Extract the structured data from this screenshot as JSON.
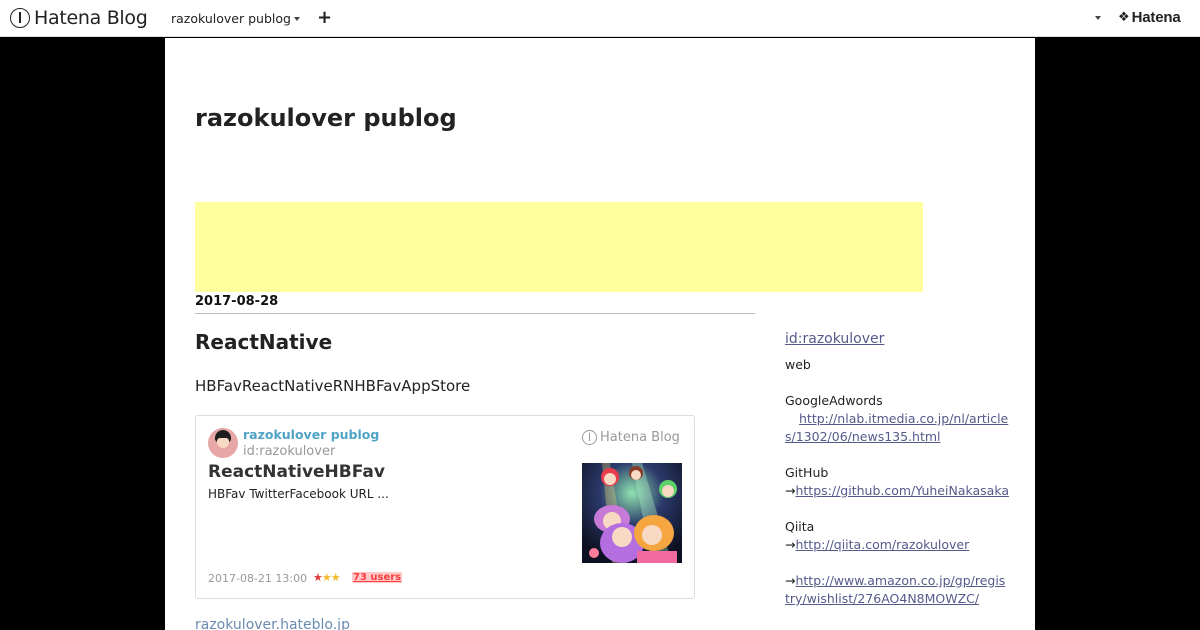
{
  "topbar": {
    "logo_text": "Hatena Blog",
    "blog_switcher_label": "razokulover publog",
    "add_label": "+",
    "brand_mark": "❖",
    "brand_text": "Hatena"
  },
  "blog": {
    "title": "razokulover publog",
    "url": "razokulover.hateblo.jp"
  },
  "ad": {
    "color": "#ffff9e"
  },
  "entry": {
    "date": "2017-08-28",
    "title": "ReactNative",
    "text": "HBFavReactNativeRNHBFavAppStore"
  },
  "card": {
    "blog_name": "razokulover publog",
    "author_id": "id:razokulover",
    "logo_text": "Hatena Blog",
    "title": "ReactNativeHBFav",
    "description": "HBFav TwitterFacebook  URL ...",
    "date": "2017-08-21 13:00",
    "stars": "★★★",
    "bookmark_users": "73 users"
  },
  "sidebar": {
    "id_link": "id:razokulover",
    "web_label": "web",
    "adwords_label": "GoogleAdwords",
    "adwords_link": "http://nlab.itmedia.co.jp/nl/articles/1302/06/news135.html",
    "github_label": "GitHub",
    "github_arrow": "→",
    "github_link": "https://github.com/YuheiNakasaka",
    "qiita_label": "Qiita",
    "qiita_arrow": "→",
    "qiita_link": "http://qiita.com/razokulover",
    "amazon_arrow": "→",
    "amazon_link": "http://www.amazon.co.jp/gp/registry/wishlist/276AO4N8MOWZC/"
  },
  "colors": {
    "accent_link": "#555a8a",
    "card_blog_name": "#4fa3c7",
    "bookmark_users": "#ff3b3b",
    "page_background": "#000000"
  }
}
